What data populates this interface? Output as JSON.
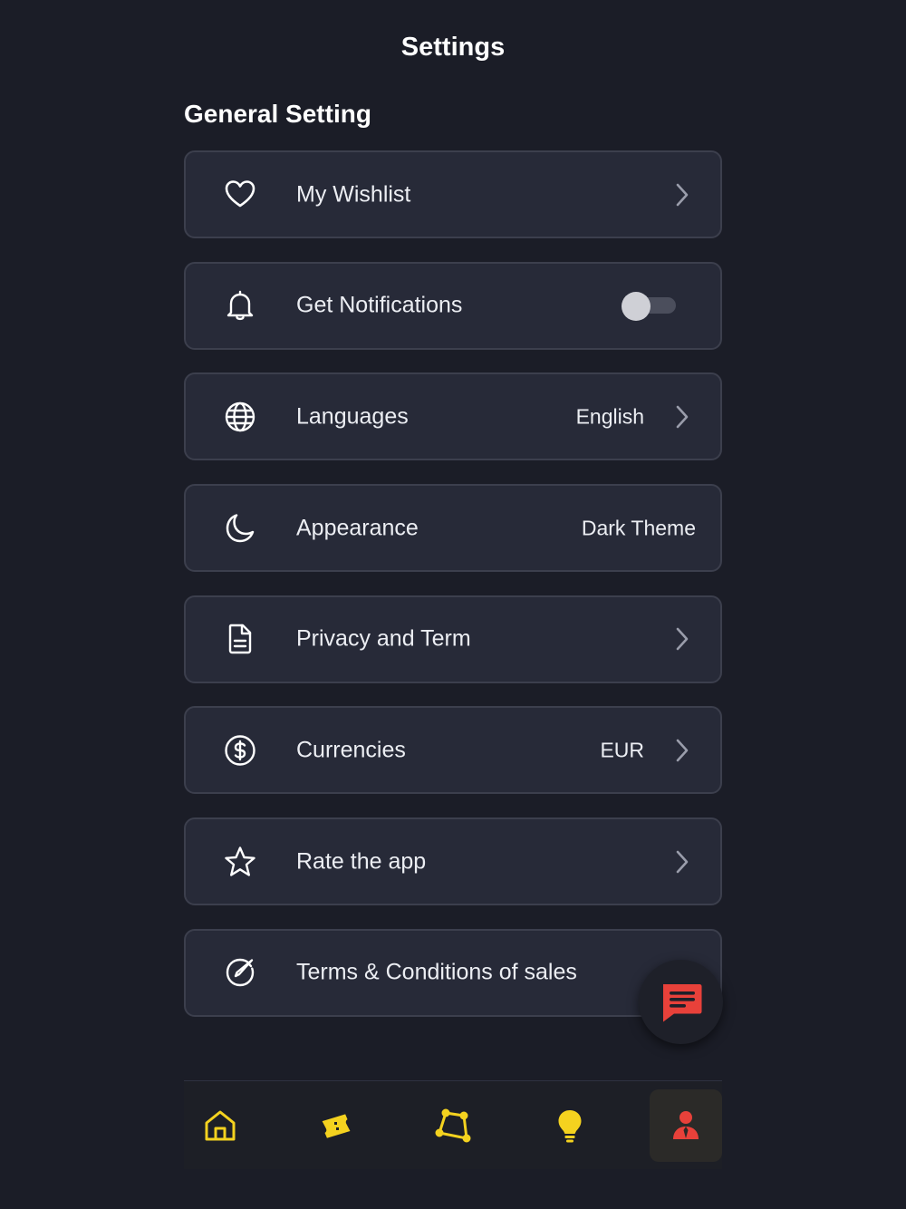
{
  "header": {
    "title": "Settings"
  },
  "section": {
    "title": "General Setting"
  },
  "settings": [
    {
      "label": "My Wishlist",
      "icon": "heart-icon",
      "value": "",
      "chevron": true
    },
    {
      "label": "Get Notifications",
      "icon": "bell-icon",
      "toggle": false
    },
    {
      "label": "Languages",
      "icon": "globe-icon",
      "value": "English",
      "chevron": true
    },
    {
      "label": "Appearance",
      "icon": "moon-icon",
      "value": "Dark Theme",
      "chevron": false
    },
    {
      "label": "Privacy and Term",
      "icon": "document-icon",
      "value": "",
      "chevron": true
    },
    {
      "label": "Currencies",
      "icon": "dollar-icon",
      "value": "EUR",
      "chevron": true
    },
    {
      "label": "Rate the app",
      "icon": "star-icon",
      "value": "",
      "chevron": true
    },
    {
      "label": "Terms & Conditions of sales",
      "icon": "pen-circle-icon",
      "value": "",
      "chevron": false
    }
  ],
  "chat_fab": {
    "icon": "chat-icon",
    "color": "#e8413a"
  },
  "bottom_nav": [
    {
      "icon": "home-icon",
      "active": false
    },
    {
      "icon": "tickets-icon",
      "active": false
    },
    {
      "icon": "shape-icon",
      "active": false
    },
    {
      "icon": "lightbulb-icon",
      "active": false
    },
    {
      "icon": "user-icon",
      "active": true
    }
  ],
  "colors": {
    "background": "#1b1d27",
    "card": "#272a38",
    "card_border": "#3c3f4d",
    "nav_icon": "#f4d21f",
    "active_icon": "#e8413a"
  }
}
